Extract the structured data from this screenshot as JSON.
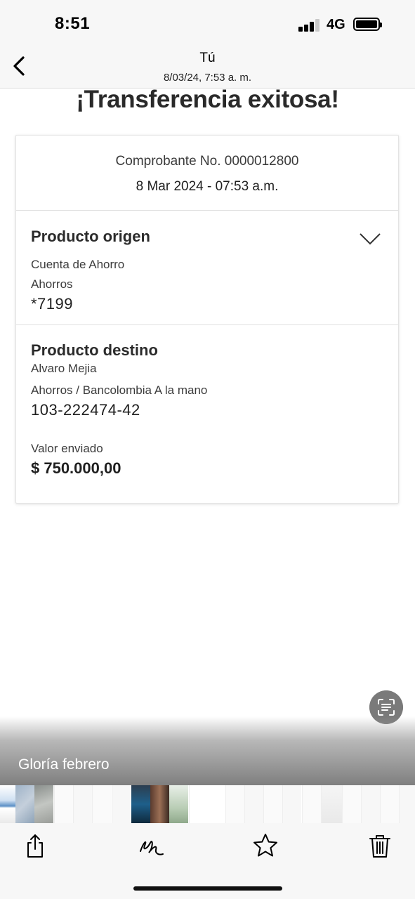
{
  "status_bar": {
    "time": "8:51",
    "network": "4G"
  },
  "header": {
    "title": "Tú",
    "subtitle": "8/03/24, 7:53 a. m."
  },
  "receipt": {
    "headline": "¡Transferencia exitosa!",
    "receipt_number": "Comprobante No. 0000012800",
    "receipt_date": "8 Mar 2024 - 07:53 a.m.",
    "origin": {
      "title": "Producto origen",
      "account_type": "Cuenta de Ahorro",
      "product": "Ahorros",
      "account_number": "*7199"
    },
    "destination": {
      "title": "Producto destino",
      "name": "Alvaro Mejia",
      "product": "Ahorros / Bancolombia A la mano",
      "account_number": "103-222474-42",
      "amount_label": "Valor enviado",
      "amount": "$ 750.000,00"
    }
  },
  "album": {
    "title": "Gloría febrero"
  },
  "toolbar": {
    "icons": [
      "share-icon",
      "markup-icon",
      "favorite-icon",
      "trash-icon"
    ]
  },
  "colors": {
    "accent_gray": "#7a7a7a",
    "text": "#2b2b2b",
    "toolbar_bg": "#f7f7f7"
  }
}
